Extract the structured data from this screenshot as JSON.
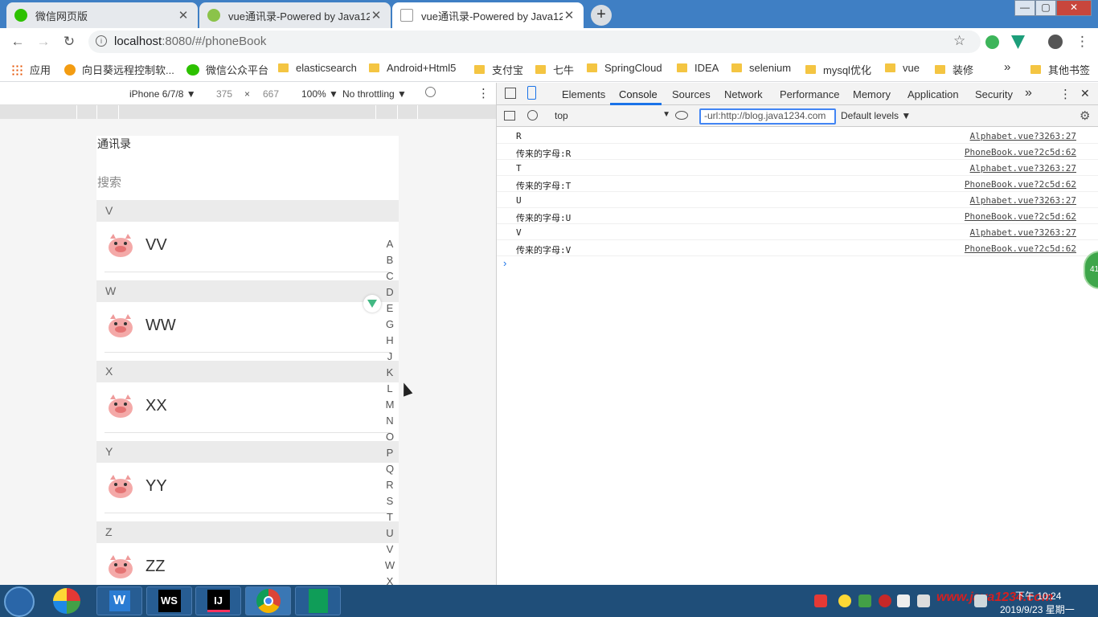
{
  "browser": {
    "tabs": [
      {
        "label": "微信网页版",
        "icon": "wechat-icon",
        "color": "#2dc100"
      },
      {
        "label": "vue通讯录-Powered by Java12",
        "icon": "leaf-icon",
        "color": "#8bc34a"
      },
      {
        "label": "vue通讯录-Powered by Java12",
        "icon": "page-icon",
        "color": "#9e9e9e"
      }
    ],
    "tab_close": "✕",
    "new_tab": "+",
    "window_controls": {
      "minimize": "—",
      "maximize": "▢",
      "close": "✕"
    },
    "url_host": "localhost",
    "url_rest": ":8080/#/phoneBook",
    "bookmarks": [
      "应用",
      "向日葵远程控制软...",
      "微信公众平台",
      "elasticsearch",
      "Android+Html5",
      "支付宝",
      "七牛",
      "SpringCloud",
      "IDEA",
      "selenium",
      "mysql优化",
      "vue",
      "装修"
    ],
    "bookmarks_more": "»",
    "other_bookmarks": "其他书签"
  },
  "device_toolbar": {
    "device": "iPhone 6/7/8 ▼",
    "width": "375",
    "times": "×",
    "height": "667",
    "zoom": "100% ▼",
    "throttle": "No throttling ▼",
    "more": "⋮"
  },
  "phone": {
    "title": "通讯录",
    "search": "搜索",
    "groups": [
      {
        "letter": "V",
        "name": "VV"
      },
      {
        "letter": "W",
        "name": "WW"
      },
      {
        "letter": "X",
        "name": "XX"
      },
      {
        "letter": "Y",
        "name": "YY"
      },
      {
        "letter": "Z",
        "name": "ZZ"
      }
    ],
    "alphabet": [
      "A",
      "B",
      "C",
      "D",
      "E",
      "G",
      "H",
      "J",
      "K",
      "L",
      "M",
      "N",
      "O",
      "P",
      "Q",
      "R",
      "S",
      "T",
      "U",
      "V",
      "W",
      "X"
    ]
  },
  "devtools": {
    "tabs": [
      "Elements",
      "Console",
      "Sources",
      "Network",
      "Performance",
      "Memory",
      "Application",
      "Security"
    ],
    "active_tab": "Console",
    "tabs_more": "»",
    "more": "⋮",
    "close": "✕",
    "context": "top",
    "context_arrow": "▼",
    "filter": "-url:http://blog.java1234.com",
    "levels": "Default levels ▼",
    "logs": [
      {
        "msg": "R",
        "src": "Alphabet.vue?3263:27"
      },
      {
        "msg": "传来的字母:R",
        "src": "PhoneBook.vue?2c5d:62"
      },
      {
        "msg": "T",
        "src": "Alphabet.vue?3263:27"
      },
      {
        "msg": "传来的字母:T",
        "src": "PhoneBook.vue?2c5d:62"
      },
      {
        "msg": "U",
        "src": "Alphabet.vue?3263:27"
      },
      {
        "msg": "传来的字母:U",
        "src": "PhoneBook.vue?2c5d:62"
      },
      {
        "msg": "V",
        "src": "Alphabet.vue?3263:27"
      },
      {
        "msg": "传来的字母:V",
        "src": "PhoneBook.vue?2c5d:62"
      }
    ],
    "prompt": "›"
  },
  "side_widget": "41",
  "taskbar": {
    "apps": [
      "W",
      "WS",
      "IJ",
      "Chrome",
      "Sheets"
    ],
    "watermark": "www.java1234.com",
    "time": "下午 10:24",
    "date": "2019/9/23 星期一"
  }
}
